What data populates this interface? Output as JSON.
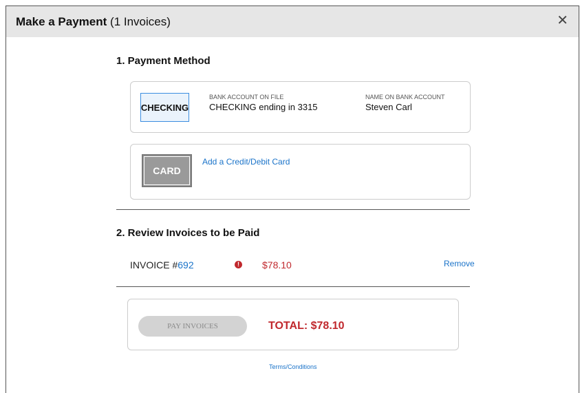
{
  "modal": {
    "title_bold": "Make a Payment",
    "title_count": "(1 Invoices)",
    "close_glyph": "✕"
  },
  "payment_method": {
    "heading": "1. Payment Method",
    "bank": {
      "badge": "CHECKING",
      "account_label": "BANK ACCOUNT ON FILE",
      "account_value": "CHECKING ending in 3315",
      "name_label": "NAME ON BANK ACCOUNT",
      "name_value": "Steven Carl"
    },
    "card": {
      "badge": "CARD",
      "add_link": "Add a Credit/Debit Card"
    }
  },
  "review": {
    "heading": "2. Review Invoices to be Paid",
    "invoices": [
      {
        "prefix": "INVOICE #",
        "number": "692",
        "alert": "!",
        "amount": "$78.10",
        "remove": "Remove"
      }
    ]
  },
  "pay": {
    "button": "PAY INVOICES",
    "total": "TOTAL: $78.10"
  },
  "terms_link": "Terms/Conditions",
  "colors": {
    "link": "#1a73c9",
    "alert": "#c0282d",
    "header_bg": "#e6e6e6"
  }
}
